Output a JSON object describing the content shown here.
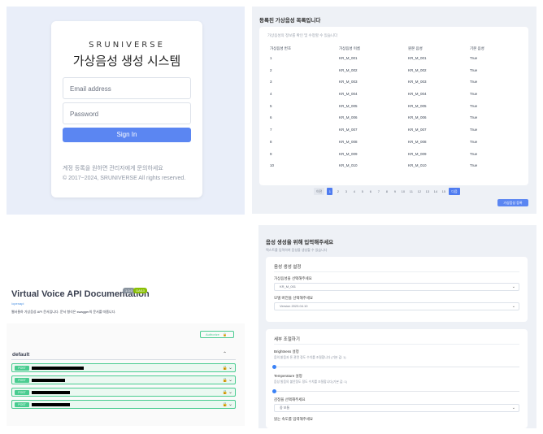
{
  "login": {
    "brand": "SRUNIVERSE",
    "title": "가상음성 생성 시스템",
    "email_placeholder": "Email address",
    "password_placeholder": "Password",
    "signin_label": "Sign In",
    "note": "계정 등록을 원하면 관리자에게 문의하세요",
    "copyright": "© 2017~2024, SRUNIVERSE All rights reserved."
  },
  "voice_list": {
    "heading": "등록된 가상음성 목록입니다",
    "subtitle": "가상음성의 정보를 확인 및 수정할 수 있습니다",
    "columns": [
      "가상음성 번호",
      "가상음성 이름",
      "원본 음성",
      "기본 음성"
    ],
    "rows": [
      [
        "1",
        "KR_M_001",
        "KR_M_001",
        "True"
      ],
      [
        "2",
        "KR_M_002",
        "KR_M_002",
        "True"
      ],
      [
        "3",
        "KR_M_003",
        "KR_M_003",
        "True"
      ],
      [
        "4",
        "KR_M_004",
        "KR_M_004",
        "True"
      ],
      [
        "5",
        "KR_M_005",
        "KR_M_005",
        "True"
      ],
      [
        "6",
        "KR_M_006",
        "KR_M_006",
        "True"
      ],
      [
        "7",
        "KR_M_007",
        "KR_M_007",
        "True"
      ],
      [
        "8",
        "KR_M_008",
        "KR_M_008",
        "True"
      ],
      [
        "9",
        "KR_M_009",
        "KR_M_009",
        "True"
      ],
      [
        "10",
        "KR_M_010",
        "KR_M_010",
        "True"
      ]
    ],
    "pagination": {
      "prev": "이전",
      "pages": [
        "1",
        "2",
        "3",
        "4",
        "5",
        "6",
        "7",
        "8",
        "9",
        "10",
        "11",
        "12",
        "13",
        "14",
        "15"
      ],
      "active": "1",
      "next": "다음"
    },
    "add_button": "가상음성 등록"
  },
  "api_doc": {
    "title": "Virtual Voice API Documentation",
    "version_badge": "1.0.0",
    "oas_badge": "OAS3",
    "link": "/openapi",
    "description": "웹서울하 가상음성 API 문서입니다. 문서 형식은 swagger의 문서를 따릅니다.",
    "authorize_label": "Authorize",
    "section": "default",
    "endpoints": [
      {
        "method": "POST"
      },
      {
        "method": "POST"
      },
      {
        "method": "POST"
      },
      {
        "method": "POST"
      }
    ],
    "method_color": "#49cc90"
  },
  "synthesis": {
    "title": "음성 생성을 위해 입력해주세요",
    "subtitle": "텍스트를 입력하여 음성을 생성할 수 있습니다",
    "settings_card": {
      "title": "음성 생성 설정",
      "voice_label": "가상음성을 선택해주세요",
      "voice_value": "KR_M_001",
      "model_label": "모델 버전을 선택해주세요",
      "model_value": "Version 2023.04.10"
    },
    "detail_card": {
      "title": "세부 조절하기",
      "brightness_label": "Brightness 설정",
      "brightness_hint": "음의 밝음과 톤 관련 정도 수치를 조절합니다 (기본 값: 1)",
      "brightness_value": 0.0,
      "temperature_label": "Temperature 설정",
      "temperature_hint": "음성 발음의 불안정도 정도 수치를 조절합니다(기본 값: 1)",
      "temperature_value": 0.0,
      "emotion_label": "감정을 선택해주세요",
      "emotion_value": "중 보통",
      "speed_label": "읽는 속도를 입력해주세요"
    }
  }
}
